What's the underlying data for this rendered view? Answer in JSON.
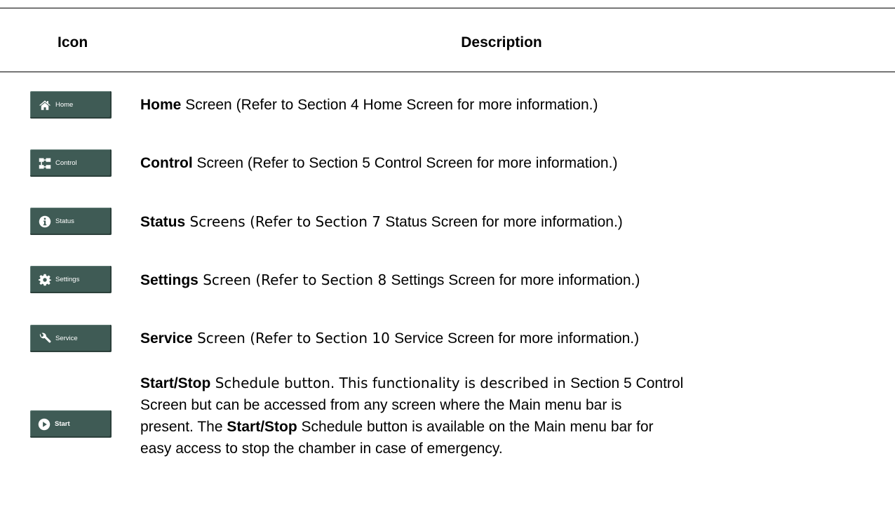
{
  "table": {
    "header": {
      "icon": "Icon",
      "description": "Description"
    },
    "rows": [
      {
        "button_label": "Home",
        "icon": "home-icon",
        "bold": "Home",
        "screen_word": " Screen ",
        "refer_prefix": "(Refer to Section 4 ",
        "refer_target": "Home Screen",
        "refer_suffix": " for more information.)"
      },
      {
        "button_label": "Control",
        "icon": "control-icon",
        "bold": "Control",
        "screen_word": " Screen ",
        "refer_prefix": "(Refer to Section 5 ",
        "refer_target": "Control Screen",
        "refer_suffix": " for more information.)"
      },
      {
        "button_label": "Status",
        "icon": "info-icon",
        "bold": "Status",
        "screen_word": " Screens ",
        "refer_prefix": "(Refer to Section 7 ",
        "refer_target": "Status Screen",
        "refer_suffix": " for more information.)"
      },
      {
        "button_label": "Settings",
        "icon": "gear-icon",
        "bold": "Settings",
        "screen_word": " Screen ",
        "refer_prefix": "(Refer to Section 8 ",
        "refer_target": "Settings Screen",
        "refer_suffix": " for more information.)"
      },
      {
        "button_label": "Service",
        "icon": "wrench-icon",
        "bold": "Service",
        "screen_word": " Screen ",
        "refer_prefix": "(Refer to Section 10 ",
        "refer_target": "Service Screen",
        "refer_suffix": " for more information.)"
      }
    ],
    "start_row": {
      "button_label": "Start",
      "icon": "play-icon",
      "line1_bold": "Start/Stop",
      "line1_text": " Schedule button. This functionality is described in ",
      "line1_ref": "Section 5 Control",
      "line2_text": "Screen but can be accessed from any screen where the Main menu bar is",
      "line3_a": "present. The ",
      "line3_bold": "Start/Stop",
      "line3_b": " Schedule button is available on the Main menu bar for",
      "line4_text": "easy access to stop the chamber in case of emergency."
    }
  },
  "colors": {
    "button_bg": "#3f5b55",
    "button_text": "#ffffff"
  }
}
